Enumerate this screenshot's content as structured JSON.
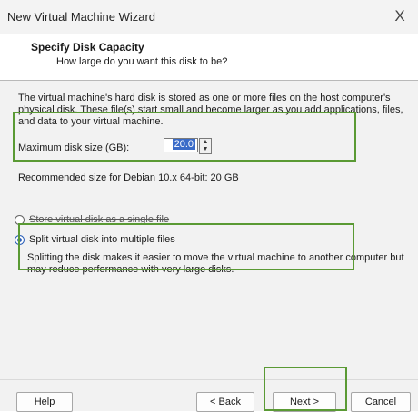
{
  "window": {
    "title": "New Virtual Machine Wizard",
    "close_glyph": "X"
  },
  "header": {
    "title": "Specify Disk Capacity",
    "subtitle": "How large do you want this disk to be?"
  },
  "body": {
    "description": "The virtual machine's hard disk is stored as one or more files on the host computer's physical disk. These file(s) start small and become larger as you add applications, files, and data to your virtual machine.",
    "max_size_label": "Maximum disk size (GB):",
    "max_size_value": "20.0",
    "recommended_text": "Recommended size for Debian 10.x 64-bit: 20 GB",
    "options": [
      {
        "label": "Store virtual disk as a single file",
        "selected": false
      },
      {
        "label": "Split virtual disk into multiple files",
        "selected": true
      }
    ],
    "split_hint": "Splitting the disk makes it easier to move the virtual machine to another computer but may reduce performance with very large disks."
  },
  "buttons": {
    "help": "Help",
    "back": "< Back",
    "next": "Next >",
    "cancel": "Cancel"
  },
  "colors": {
    "highlight": "#5a9a34",
    "selection": "#3a6bc8"
  }
}
